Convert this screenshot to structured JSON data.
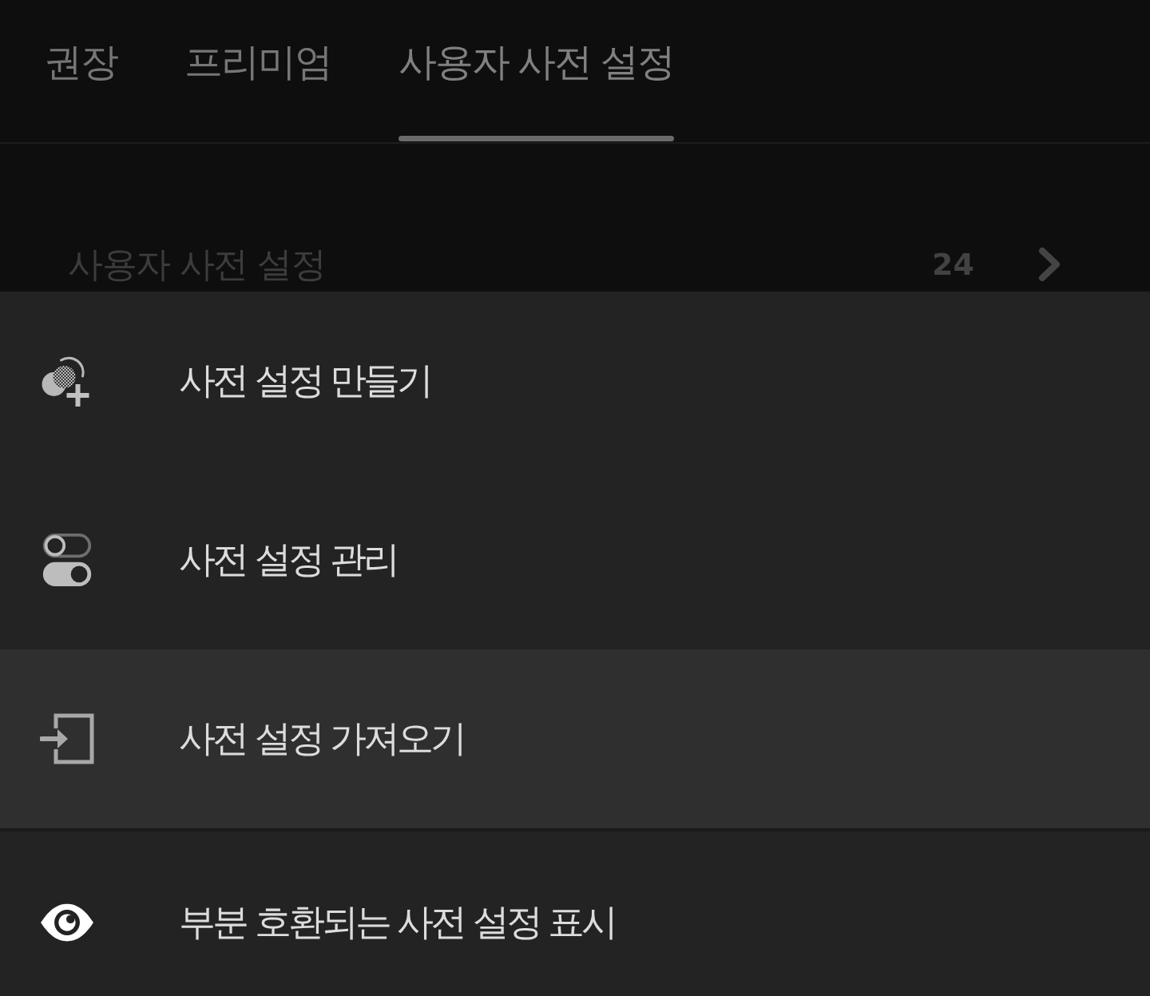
{
  "tabs": [
    {
      "label": "권장",
      "selected": false
    },
    {
      "label": "프리미엄",
      "selected": false
    },
    {
      "label": "사용자 사전 설정",
      "selected": true
    }
  ],
  "section": {
    "label": "사용자 사전 설정",
    "count": "24"
  },
  "menu": {
    "groups": [
      {
        "items": [
          {
            "kind": "create",
            "label": "사전 설정 만들기",
            "selected": false
          },
          {
            "kind": "manage",
            "label": "사전 설정 관리",
            "selected": false
          },
          {
            "kind": "import",
            "label": "사전 설정 가져오기",
            "selected": true
          }
        ]
      },
      {
        "items": [
          {
            "kind": "show",
            "label": "부분 호환되는 사전 설정 표시",
            "selected": false
          }
        ]
      }
    ]
  }
}
